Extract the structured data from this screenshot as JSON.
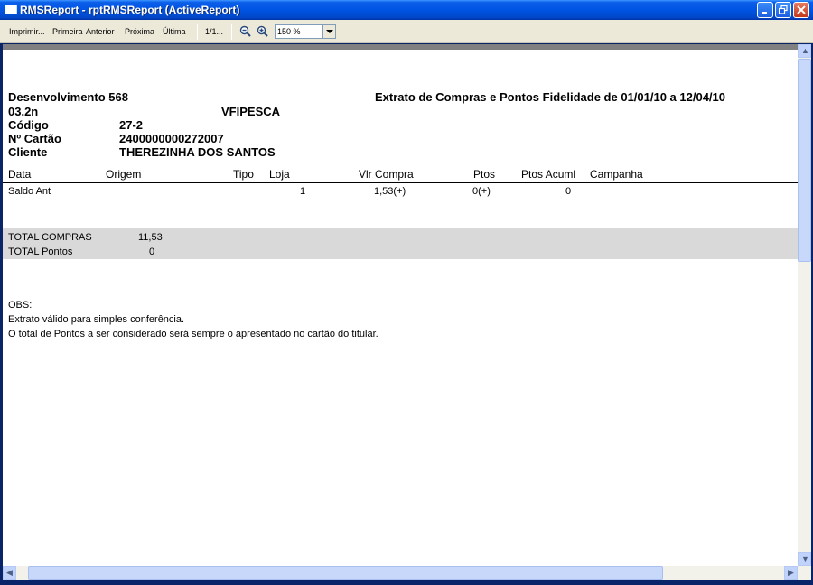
{
  "window": {
    "title": "RMSReport - rptRMSReport (ActiveReport)"
  },
  "toolbar": {
    "print": "Imprimir...",
    "first": "Primeira",
    "previous": "Anterior",
    "next": "Próxima",
    "last": "Última",
    "page": "1/1...",
    "zoom_value": "150 %"
  },
  "report": {
    "company": "Desenvolvimento 568",
    "version": "03.2n",
    "store_code": "VFIPESCA",
    "heading": "Extrato de Compras e Pontos Fidelidade de 01/01/10 a 12/04/10",
    "codigo_label": "Código",
    "codigo_value": "27-2",
    "cartao_label": "Nº Cartão",
    "cartao_value": "2400000000272007",
    "cliente_label": "Cliente",
    "cliente_value": "THEREZINHA DOS SANTOS",
    "columns": {
      "data": "Data",
      "origem": "Origem",
      "tipo": "Tipo",
      "loja": "Loja",
      "vlr_compra": "Vlr Compra",
      "ptos": "Ptos",
      "ptos_acuml": "Ptos Acuml",
      "campanha": "Campanha"
    },
    "row": {
      "data": "Saldo Ant",
      "loja": "1",
      "vlr_compra": "1,53(+)",
      "ptos": "0(+)",
      "ptos_acuml": "0"
    },
    "totals": {
      "compras_label": "TOTAL COMPRAS",
      "compras_value": "11,53",
      "pontos_label": "TOTAL Pontos",
      "pontos_value": "0"
    },
    "obs": {
      "label": "OBS:",
      "line1": "Extrato válido para simples conferência.",
      "line2": "O total de Pontos a ser considerado será sempre o apresentado no cartão do titular."
    }
  }
}
